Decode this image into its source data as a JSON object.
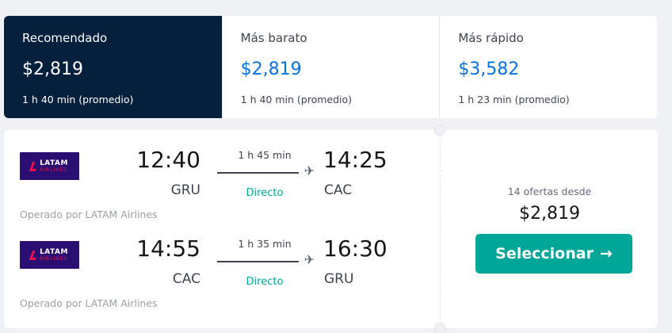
{
  "sort_tabs": [
    {
      "label": "Recomendado",
      "price": "$2,819",
      "duration": "1 h 40 min (promedio)",
      "active": true
    },
    {
      "label": "Más barato",
      "price": "$2,819",
      "duration": "1 h 40 min (promedio)",
      "active": false
    },
    {
      "label": "Más rápido",
      "price": "$3,582",
      "duration": "1 h 23 min (promedio)",
      "active": false
    }
  ],
  "result": {
    "legs": [
      {
        "airline_logo_top": "LATAM",
        "airline_logo_bottom": "AIRLINES",
        "depart_time": "12:40",
        "depart_place": "GRU",
        "duration": "1 h 45 min",
        "stops": "Directo",
        "arrive_time": "14:25",
        "arrive_place": "CAC",
        "operated_by": "Operado por LATAM Airlines"
      },
      {
        "airline_logo_top": "LATAM",
        "airline_logo_bottom": "AIRLINES",
        "depart_time": "14:55",
        "depart_place": "CAC",
        "duration": "1 h 35 min",
        "stops": "Directo",
        "arrive_time": "16:30",
        "arrive_place": "GRU",
        "operated_by": "Operado por LATAM Airlines"
      }
    ],
    "offers_text": "14 ofertas desde",
    "price": "$2,819",
    "select_label": "Seleccionar",
    "select_arrow": "→"
  },
  "icons": {
    "plane": "plane-icon",
    "arrow": "arrow-right-icon"
  },
  "colors": {
    "active_tab_bg": "#05203c",
    "price_blue": "#0770e3",
    "accent_teal": "#00a698",
    "airline_purple": "#2b0e72",
    "airline_red": "#e8114b"
  }
}
